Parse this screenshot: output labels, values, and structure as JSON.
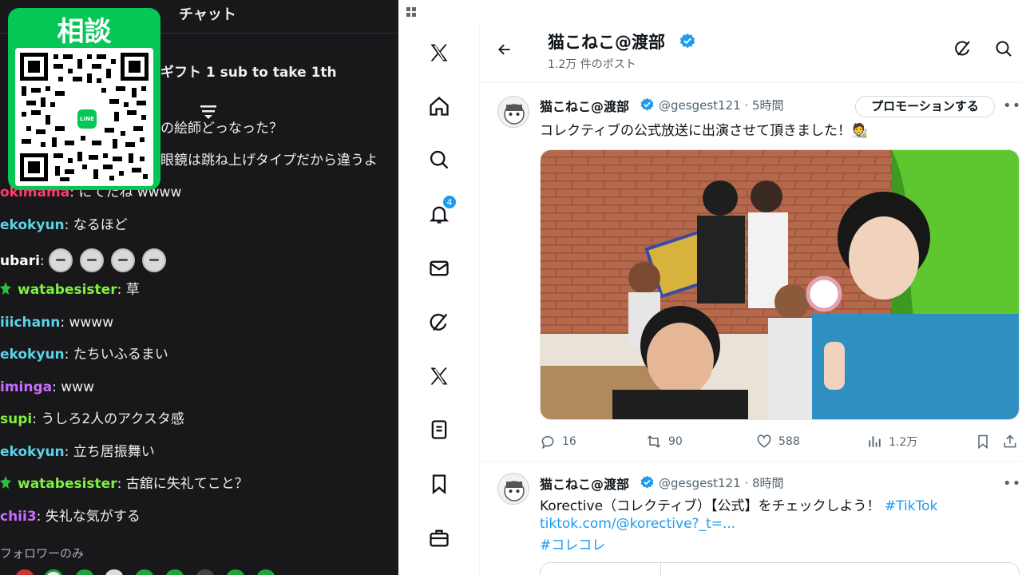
{
  "chat": {
    "title": "チャット",
    "qr_label": "相談",
    "qr_brand": "LINE",
    "gift_text": "ギフト 1 sub to take 1th",
    "messages": [
      {
        "user": "",
        "text": "の絵師どっなった？",
        "color": "#ff5c5c"
      },
      {
        "user": "",
        "text": "眼鏡は跳ね上げタイプだから違うよ",
        "color": "#00ff7f"
      },
      {
        "user": "okimama",
        "text": "にてたね wwww",
        "color": "#ff3b6b"
      },
      {
        "user": "ekokyun",
        "text": "なるほど",
        "color": "#5bd2e6"
      },
      {
        "user": "ubari",
        "text": "",
        "color": "#ffffff",
        "emotes": 4
      },
      {
        "user": "watabesister",
        "text": "草",
        "color": "#7ef03f",
        "badge": true
      },
      {
        "user": "iiichann",
        "text": "wwww",
        "color": "#5bd2e6"
      },
      {
        "user": "ekokyun",
        "text": "たちいふるまい",
        "color": "#5bd2e6"
      },
      {
        "user": "iminga",
        "text": "www",
        "color": "#c86cff"
      },
      {
        "user": "supi",
        "text": "うしろ2人のアクスタ感",
        "color": "#7ef03f"
      },
      {
        "user": "ekokyun",
        "text": "立ち居振舞い",
        "color": "#5bd2e6"
      },
      {
        "user": "watabesister",
        "text": "古舘に失礼てこと？",
        "color": "#7ef03f",
        "badge": true
      },
      {
        "user": "chii3",
        "text": "失礼な気がする",
        "color": "#c86cff"
      }
    ],
    "followers_only": "フォロワーのみ"
  },
  "x": {
    "nav": [
      "x-logo-icon",
      "home-icon",
      "search-icon",
      "notifications-icon",
      "messages-icon",
      "grok-icon",
      "premium-x-icon",
      "lists-icon",
      "bookmarks-icon",
      "jobs-icon"
    ],
    "notification_count": "4",
    "profile": {
      "name": "猫こねこ@渡部",
      "post_count": "1.2万 件のポスト"
    },
    "posts": [
      {
        "name": "猫こねこ@渡部",
        "handle": "@gesgest121 · 5時間",
        "promo_label": "プロモーションする",
        "text": "コレクティブの公式放送に出演させて頂きました！🧑‍🎨",
        "replies": "16",
        "reposts": "90",
        "likes": "588",
        "views": "1.2万"
      },
      {
        "name": "猫こねこ@渡部",
        "handle": "@gesgest121 · 8時間",
        "text_prefix": "Korective（コレクティブ）【公式】をチェックしよう！",
        "hashtag1": "#TikTok",
        "link": "tiktok.com/@korective?_t=...",
        "hashtag2": "#コレコレ"
      }
    ]
  },
  "colors": {
    "line_green": "#06c755",
    "x_blue": "#1d9bf0",
    "chat_bg": "#18181b"
  }
}
